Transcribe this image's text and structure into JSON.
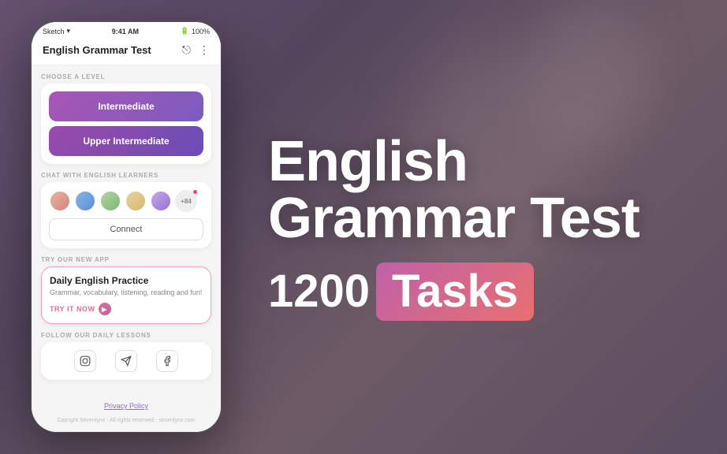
{
  "background": {
    "color": "#7a6080"
  },
  "phone": {
    "status_bar": {
      "carrier": "Sketch",
      "time": "9:41 AM",
      "battery": "100%"
    },
    "header": {
      "title": "English Grammar Test",
      "share_icon": "share",
      "more_icon": "more"
    },
    "choose_level": {
      "label": "CHOOSE A LEVEL",
      "levels": [
        {
          "id": "intermediate",
          "label": "Intermediate",
          "style": "intermediate"
        },
        {
          "id": "upper-intermediate",
          "label": "Upper Intermediate",
          "style": "upper-intermediate"
        }
      ]
    },
    "chat_section": {
      "label": "CHAT WITH ENGLISH LEARNERS",
      "avatar_count": "+84",
      "connect_button": "Connect"
    },
    "new_app_section": {
      "label": "TRY OUR NEW APP",
      "title": "Daily English Practice",
      "description": "Grammar, vocabulary, listening, reading and fun!",
      "cta": "TRY IT NOW"
    },
    "social_section": {
      "label": "FOLLOW OUR DAILY LESSONS",
      "instagram": "instagram",
      "telegram": "telegram",
      "facebook": "facebook"
    },
    "footer": {
      "privacy_link": "Privacy Policy",
      "copyright": "Copright Sevenlynx - All rights reserved - sevenlynx.com"
    }
  },
  "hero": {
    "title_line1": "English",
    "title_line2": "Grammar Test",
    "tasks_number": "1200",
    "tasks_label": "Tasks"
  }
}
